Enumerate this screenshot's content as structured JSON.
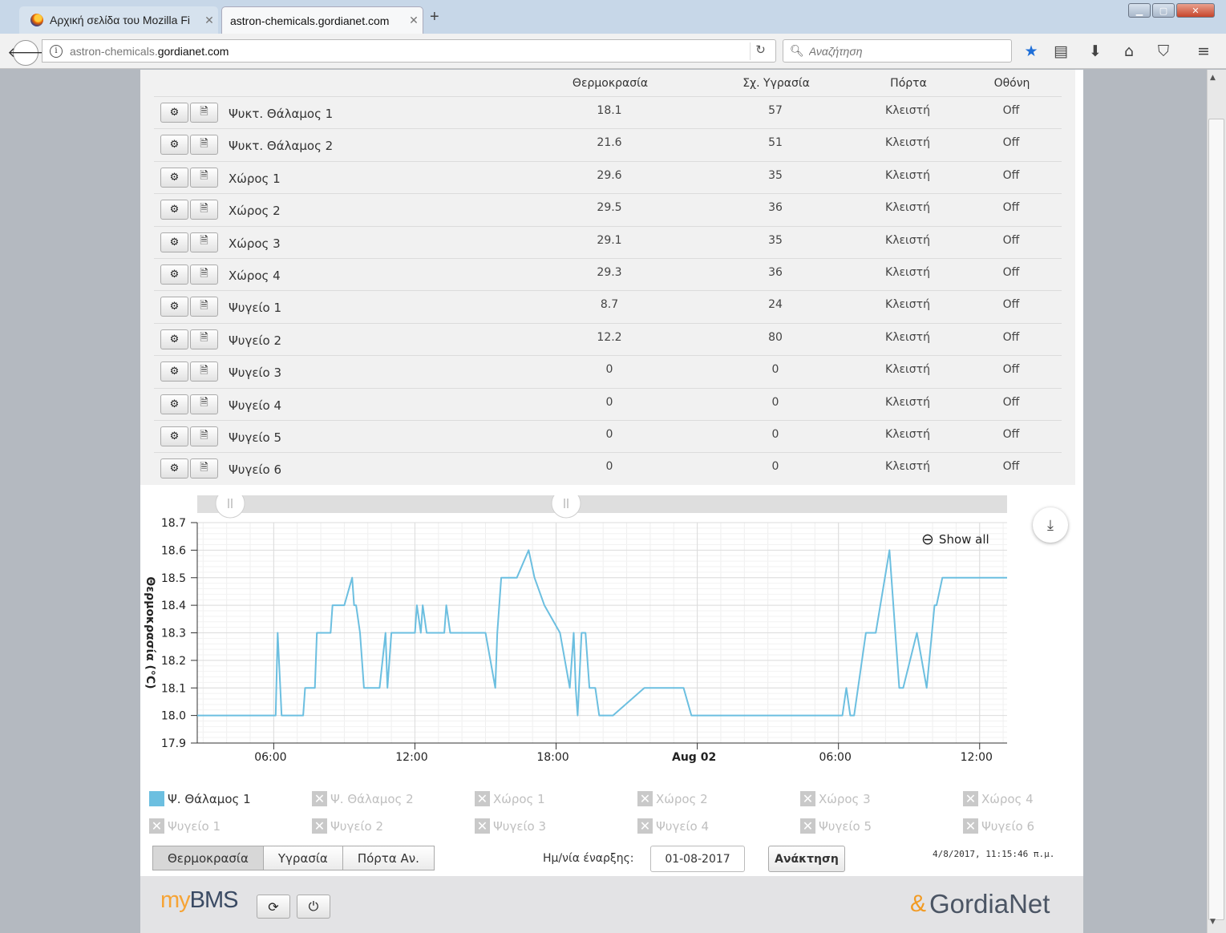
{
  "browser": {
    "tabs": [
      {
        "title": "Αρχική σελίδα του Mozilla Fi"
      },
      {
        "title": "astron-chemicals.gordianet.com"
      }
    ],
    "url_prefix": "astron-chemicals.",
    "url_domain": "gordianet.com",
    "search_placeholder": "Αναζήτηση"
  },
  "table": {
    "headers": {
      "temp": "Θερμοκρασία",
      "humidity": "Σχ. Υγρασία",
      "door": "Πόρτα",
      "screen": "Οθόνη"
    },
    "rows": [
      {
        "name": "Ψυκτ. Θάλαμος 1",
        "temp": "18.1",
        "humidity": "57",
        "door": "Κλειστή",
        "screen": "Off"
      },
      {
        "name": "Ψυκτ. Θάλαμος 2",
        "temp": "21.6",
        "humidity": "51",
        "door": "Κλειστή",
        "screen": "Off"
      },
      {
        "name": "Χώρος 1",
        "temp": "29.6",
        "humidity": "35",
        "door": "Κλειστή",
        "screen": "Off"
      },
      {
        "name": "Χώρος 2",
        "temp": "29.5",
        "humidity": "36",
        "door": "Κλειστή",
        "screen": "Off"
      },
      {
        "name": "Χώρος 3",
        "temp": "29.1",
        "humidity": "35",
        "door": "Κλειστή",
        "screen": "Off"
      },
      {
        "name": "Χώρος 4",
        "temp": "29.3",
        "humidity": "36",
        "door": "Κλειστή",
        "screen": "Off"
      },
      {
        "name": "Ψυγείο 1",
        "temp": "8.7",
        "humidity": "24",
        "door": "Κλειστή",
        "screen": "Off"
      },
      {
        "name": "Ψυγείο 2",
        "temp": "12.2",
        "humidity": "80",
        "door": "Κλειστή",
        "screen": "Off"
      },
      {
        "name": "Ψυγείο 3",
        "temp": "0",
        "humidity": "0",
        "door": "Κλειστή",
        "screen": "Off"
      },
      {
        "name": "Ψυγείο 4",
        "temp": "0",
        "humidity": "0",
        "door": "Κλειστή",
        "screen": "Off"
      },
      {
        "name": "Ψυγείο 5",
        "temp": "0",
        "humidity": "0",
        "door": "Κλειστή",
        "screen": "Off"
      },
      {
        "name": "Ψυγείο 6",
        "temp": "0",
        "humidity": "0",
        "door": "Κλειστή",
        "screen": "Off"
      }
    ]
  },
  "chart": {
    "show_all_label": "Show all",
    "legend": [
      {
        "label": "Ψ. Θάλαμος 1",
        "on": true
      },
      {
        "label": "Ψ. Θάλαμος 2",
        "on": false
      },
      {
        "label": "Χώρος 1",
        "on": false
      },
      {
        "label": "Χώρος 2",
        "on": false
      },
      {
        "label": "Χώρος 3",
        "on": false
      },
      {
        "label": "Χώρος 4",
        "on": false
      },
      {
        "label": "Ψυγείο 1",
        "on": false
      },
      {
        "label": "Ψυγείο 2",
        "on": false
      },
      {
        "label": "Ψυγείο 3",
        "on": false
      },
      {
        "label": "Ψυγείο 4",
        "on": false
      },
      {
        "label": "Ψυγείο 5",
        "on": false
      },
      {
        "label": "Ψυγείο 6",
        "on": false
      }
    ]
  },
  "chart_data": {
    "type": "line",
    "ylabel": "Θερμοκρασία (°C)",
    "ylim": [
      17.9,
      18.7
    ],
    "yticks": [
      "18.7",
      "18.6",
      "18.5",
      "18.4",
      "18.3",
      "18.2",
      "18.1",
      "18.0",
      "17.9"
    ],
    "xlim": [
      "2017-08-01 02:45",
      "2017-08-02 13:10"
    ],
    "xticks": [
      {
        "t": "2017-08-01 06:00",
        "label": "06:00",
        "bold": false
      },
      {
        "t": "2017-08-01 12:00",
        "label": "12:00",
        "bold": false
      },
      {
        "t": "2017-08-01 18:00",
        "label": "18:00",
        "bold": false
      },
      {
        "t": "2017-08-02 00:00",
        "label": "Aug 02",
        "bold": true
      },
      {
        "t": "2017-08-02 06:00",
        "label": "06:00",
        "bold": false
      },
      {
        "t": "2017-08-02 12:00",
        "label": "12:00",
        "bold": false
      }
    ],
    "grid": true,
    "color": "#6cbfe0",
    "series": [
      {
        "name": "Ψ. Θάλαμος 1",
        "x": [
          "2017-08-01 02:45",
          "2017-08-01 06:05",
          "2017-08-01 06:10",
          "2017-08-01 06:20",
          "2017-08-01 07:15",
          "2017-08-01 07:20",
          "2017-08-01 07:45",
          "2017-08-01 07:50",
          "2017-08-01 08:25",
          "2017-08-01 08:30",
          "2017-08-01 09:00",
          "2017-08-01 09:20",
          "2017-08-01 09:25",
          "2017-08-01 09:30",
          "2017-08-01 09:40",
          "2017-08-01 09:50",
          "2017-08-01 10:30",
          "2017-08-01 10:45",
          "2017-08-01 10:50",
          "2017-08-01 11:00",
          "2017-08-01 12:00",
          "2017-08-01 12:05",
          "2017-08-01 12:15",
          "2017-08-01 12:20",
          "2017-08-01 12:30",
          "2017-08-01 12:40",
          "2017-08-01 13:15",
          "2017-08-01 13:20",
          "2017-08-01 13:30",
          "2017-08-01 15:00",
          "2017-08-01 15:25",
          "2017-08-01 15:30",
          "2017-08-01 15:40",
          "2017-08-01 16:20",
          "2017-08-01 16:50",
          "2017-08-01 17:05",
          "2017-08-01 17:30",
          "2017-08-01 18:10",
          "18:35",
          "2017-08-01 18:45",
          "2017-08-01 18:50",
          "2017-08-01 18:55",
          "2017-08-01 19:05",
          "2017-08-01 19:15",
          "2017-08-01 19:25",
          "2017-08-01 19:40",
          "2017-08-01 19:50",
          "2017-08-01 20:25",
          "2017-08-01 21:45",
          "2017-08-01 23:25",
          "2017-08-01 23:45",
          "2017-08-02 01:40",
          "2017-08-02 03:00",
          "2017-08-02 03:40",
          "2017-08-02 05:10",
          "2017-08-02 06:10",
          "2017-08-02 06:20",
          "2017-08-02 06:30",
          "2017-08-02 06:40",
          "2017-08-02 07:10",
          "2017-08-02 07:35",
          "2017-08-02 08:10",
          "2017-08-02 08:25",
          "2017-08-02 08:35",
          "2017-08-02 08:45",
          "2017-08-02 09:20",
          "2017-08-02 09:45",
          "2017-08-02 10:05",
          "2017-08-02 10:10",
          "2017-08-02 10:25",
          "2017-08-02 10:35",
          "2017-08-02 11:05",
          "2017-08-02 11:30",
          "2017-08-02 12:10",
          "2017-08-02 13:10"
        ],
        "y": [
          18.0,
          18.0,
          18.3,
          18.0,
          18.0,
          18.1,
          18.1,
          18.3,
          18.3,
          18.4,
          18.4,
          18.5,
          18.4,
          18.4,
          18.3,
          18.1,
          18.1,
          18.3,
          18.1,
          18.3,
          18.3,
          18.4,
          18.3,
          18.4,
          18.3,
          18.3,
          18.3,
          18.4,
          18.3,
          18.3,
          18.1,
          18.3,
          18.5,
          18.5,
          18.6,
          18.5,
          18.4,
          18.3,
          18.1,
          18.3,
          18.1,
          18.0,
          18.3,
          18.3,
          18.1,
          18.1,
          18.0,
          18.0,
          18.1,
          18.1,
          18.0,
          18.0,
          18.0,
          18.0,
          18.0,
          18.0,
          18.1,
          18.0,
          18.0,
          18.3,
          18.3,
          18.6,
          18.3,
          18.1,
          18.1,
          18.3,
          18.1,
          18.4,
          18.4,
          18.5,
          18.5,
          18.5,
          18.5,
          18.5,
          18.5
        ]
      }
    ]
  },
  "controls": {
    "tabs": [
      "Θερμοκρασία",
      "Υγρασία",
      "Πόρτα Αν."
    ],
    "date_label": "Ημ/νία έναρξης:",
    "date_value": "01-08-2017",
    "fetch_label": "Ανάκτηση",
    "timestamp": "4/8/2017, 11:15:46 π.μ."
  },
  "footer": {
    "logo_my": "my",
    "logo_bms": "BMS",
    "brand": "GordiaNet"
  }
}
